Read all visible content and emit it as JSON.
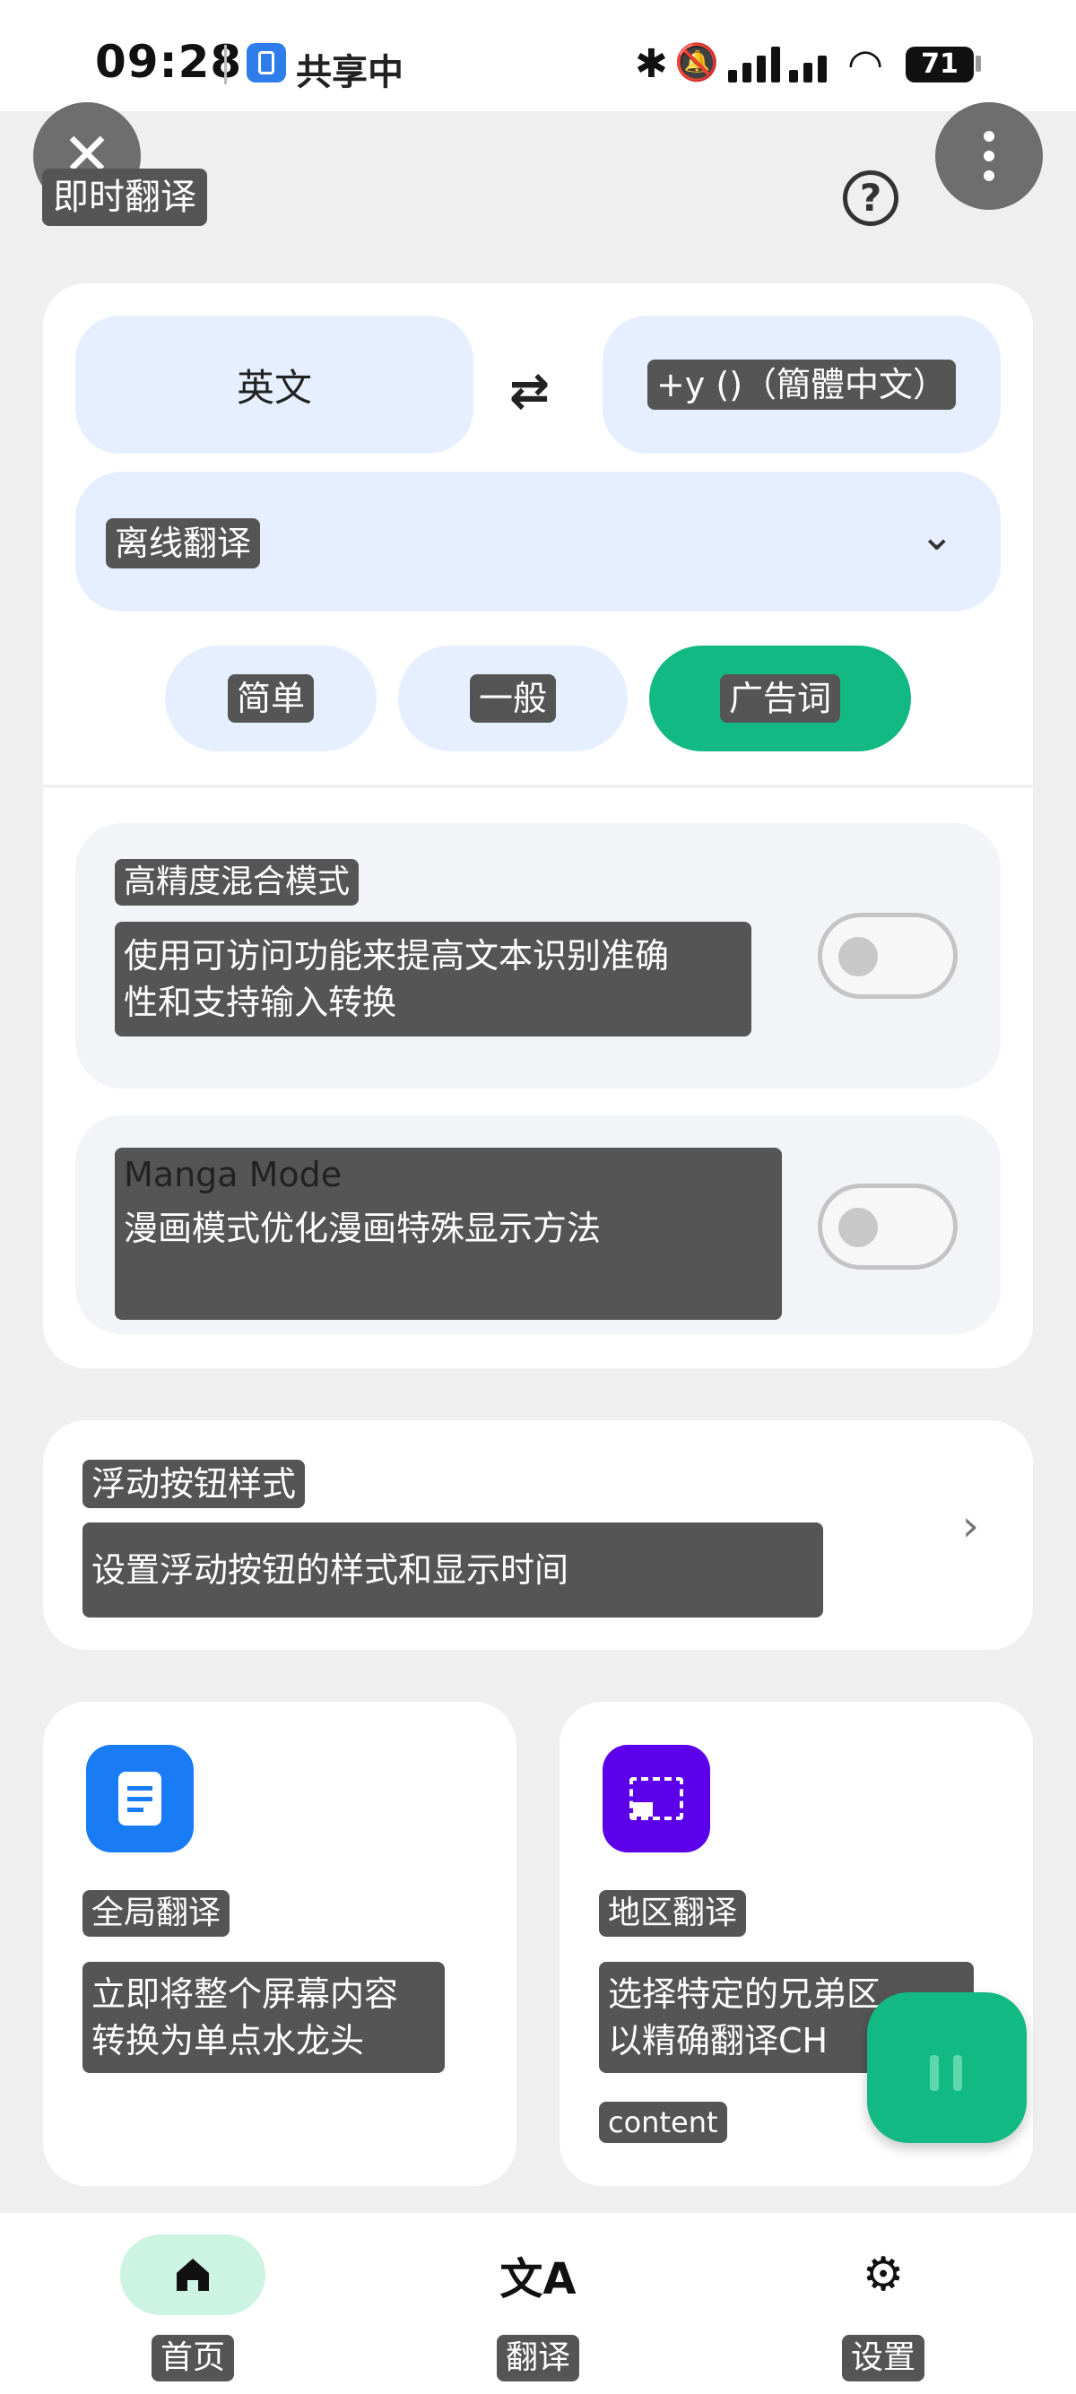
{
  "status_bar": {
    "time": "09:28",
    "share_text": "共享中",
    "battery": "71",
    "icons": [
      "share-screen-icon",
      "bluetooth-icon",
      "mute-icon",
      "signal-icon",
      "wifi-icon",
      "battery-icon"
    ]
  },
  "app_bar": {
    "title": "即时翻译",
    "icons": [
      "close-icon",
      "help-icon",
      "more-icon"
    ]
  },
  "languages": {
    "source": "英文",
    "target": "+y ()（簡體中文）",
    "swap_icon": "swap-icon"
  },
  "engine": {
    "selected": "离线翻译",
    "chevron_icon": "chevron-down-icon"
  },
  "modes": [
    {
      "label": "简单",
      "active": false
    },
    {
      "label": "一般",
      "active": false
    },
    {
      "label": "广告词",
      "active": true
    }
  ],
  "options": [
    {
      "title": "高精度混合模式",
      "desc_line1": "使用可访问功能来提高文本识别准确",
      "desc_line2": "性和支持输入转换",
      "enabled": false
    },
    {
      "title": "Manga Mode",
      "desc": "漫画模式优化漫画特殊显示方法",
      "enabled": false
    }
  ],
  "float_button": {
    "title": "浮动按钮样式",
    "desc": "设置浮动按钮的样式和显示时间",
    "arrow_icon": "chevron-right-icon"
  },
  "features": [
    {
      "title": "全局翻译",
      "desc_line1": "立即将整个屏幕内容",
      "desc_line2": "转换为单点水龙头",
      "icon": "document-icon",
      "color": "#1a7cf5"
    },
    {
      "title": "地区翻译",
      "desc_line1": "选择特定的兄弟区，",
      "desc_line2": "以精确翻译CH",
      "sub": "content",
      "icon": "region-select-icon",
      "color": "#5b00e8"
    }
  ],
  "fab": {
    "icon": "pause-icon",
    "color": "#13b982"
  },
  "bottom_nav": [
    {
      "label": "首页",
      "icon": "home-icon",
      "active": true
    },
    {
      "label": "翻译",
      "icon": "translate-icon",
      "active": false
    },
    {
      "label": "设置",
      "icon": "gear-icon",
      "active": false
    }
  ],
  "colors": {
    "accent": "#13b982",
    "pill_bg": "#e6efff",
    "chip_overlay": "#555555"
  }
}
